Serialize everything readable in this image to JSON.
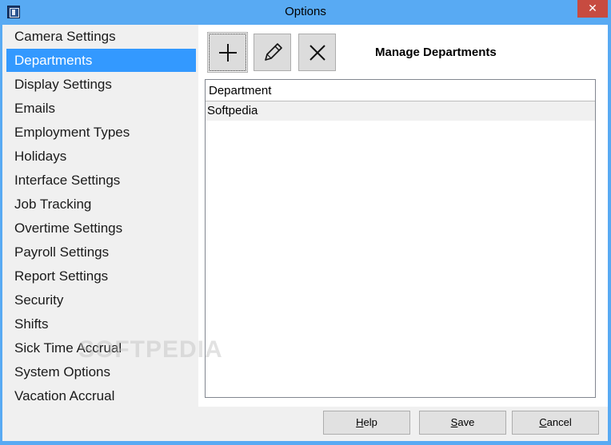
{
  "window": {
    "title": "Options",
    "close_label": "✕"
  },
  "sidebar": {
    "items": [
      {
        "label": "Camera Settings",
        "active": false
      },
      {
        "label": "Departments",
        "active": true
      },
      {
        "label": "Display Settings",
        "active": false
      },
      {
        "label": "Emails",
        "active": false
      },
      {
        "label": "Employment Types",
        "active": false
      },
      {
        "label": "Holidays",
        "active": false
      },
      {
        "label": "Interface Settings",
        "active": false
      },
      {
        "label": "Job Tracking",
        "active": false
      },
      {
        "label": "Overtime Settings",
        "active": false
      },
      {
        "label": "Payroll Settings",
        "active": false
      },
      {
        "label": "Report Settings",
        "active": false
      },
      {
        "label": "Security",
        "active": false
      },
      {
        "label": "Shifts",
        "active": false
      },
      {
        "label": "Sick Time Accrual",
        "active": false
      },
      {
        "label": "System Options",
        "active": false
      },
      {
        "label": "Vacation Accrual",
        "active": false
      }
    ]
  },
  "main": {
    "heading": "Manage Departments",
    "toolbar": {
      "add_icon": "plus-icon",
      "edit_icon": "pencil-icon",
      "delete_icon": "x-icon"
    },
    "grid": {
      "columns": [
        "Department"
      ],
      "rows": [
        [
          "Softpedia"
        ]
      ]
    }
  },
  "watermark": "SOFTPEDIA",
  "footer": {
    "help": {
      "acc": "H",
      "rest": "elp"
    },
    "save": {
      "acc": "S",
      "rest": "ave"
    },
    "cancel": {
      "acc": "C",
      "rest": "ancel"
    }
  },
  "colors": {
    "titlebar": "#58aaf3",
    "selection": "#3399ff",
    "close": "#c74b40"
  }
}
